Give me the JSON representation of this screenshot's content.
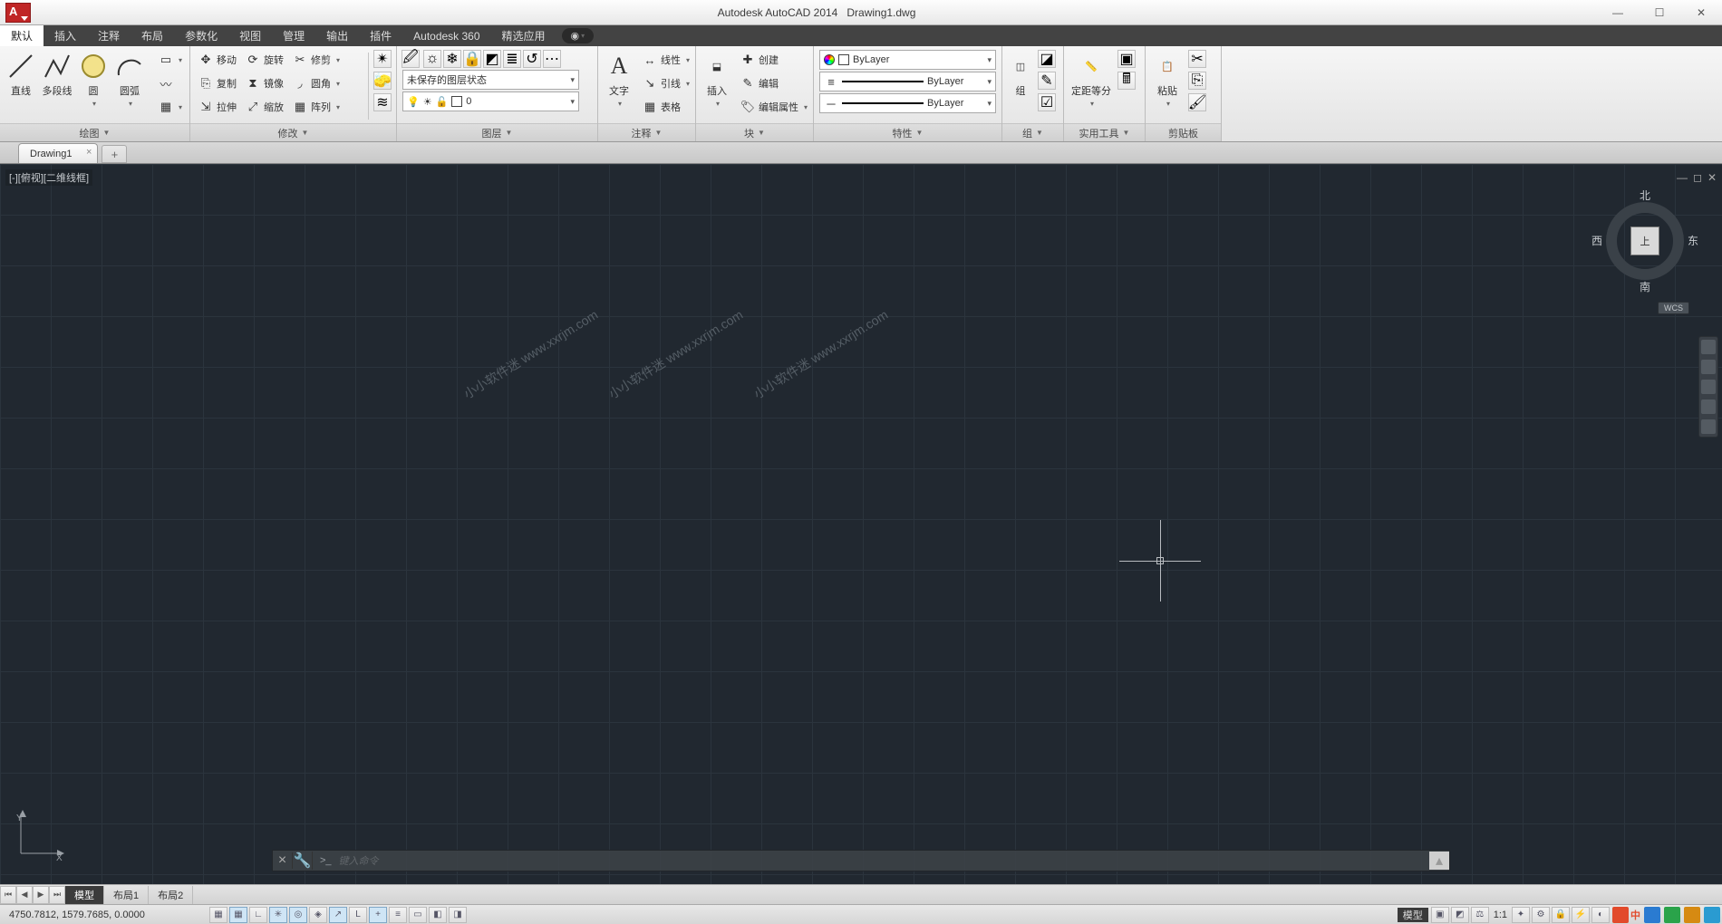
{
  "title": {
    "app": "Autodesk AutoCAD 2014",
    "file": "Drawing1.dwg"
  },
  "menubar": {
    "items": [
      "默认",
      "插入",
      "注释",
      "布局",
      "参数化",
      "视图",
      "管理",
      "输出",
      "插件",
      "Autodesk 360",
      "精选应用"
    ],
    "active_index": 0
  },
  "ribbon": {
    "draw": {
      "title": "绘图",
      "line": "直线",
      "polyline": "多段线",
      "circle": "圆",
      "arc": "圆弧"
    },
    "modify": {
      "title": "修改",
      "move": "移动",
      "rotate": "旋转",
      "trim": "修剪",
      "copy": "复制",
      "mirror": "镜像",
      "fillet": "圆角",
      "stretch": "拉伸",
      "scale": "缩放",
      "array": "阵列"
    },
    "layers": {
      "title": "图层",
      "state": "未保存的图层状态",
      "current": "0"
    },
    "annot": {
      "title": "注释",
      "text": "文字",
      "linear": "线性",
      "leader": "引线",
      "table": "表格"
    },
    "block": {
      "title": "块",
      "insert": "插入",
      "create": "创建",
      "edit": "编辑",
      "editattr": "编辑属性"
    },
    "props": {
      "title": "特性",
      "bylayer": "ByLayer"
    },
    "group": {
      "title": "组",
      "label": "组"
    },
    "util": {
      "title": "实用工具",
      "measure": "定距等分"
    },
    "clip": {
      "title": "剪贴板",
      "paste": "粘贴"
    }
  },
  "filetab": {
    "name": "Drawing1"
  },
  "viewport": {
    "label": "[-][俯视][二维线框]",
    "cube": {
      "n": "北",
      "s": "南",
      "e": "东",
      "w": "西",
      "top": "上"
    },
    "wcs": "WCS"
  },
  "watermark": "小小软件迷 www.xxrjm.com",
  "cmd": {
    "prompt": ">_",
    "hint": "键入命令"
  },
  "layout_tabs": {
    "model": "模型",
    "l1": "布局1",
    "l2": "布局2"
  },
  "status": {
    "coords": "4750.7812, 1579.7685, 0.0000",
    "model": "模型",
    "scale": "1:1"
  },
  "ucs": {
    "x": "X",
    "y": "Y"
  }
}
